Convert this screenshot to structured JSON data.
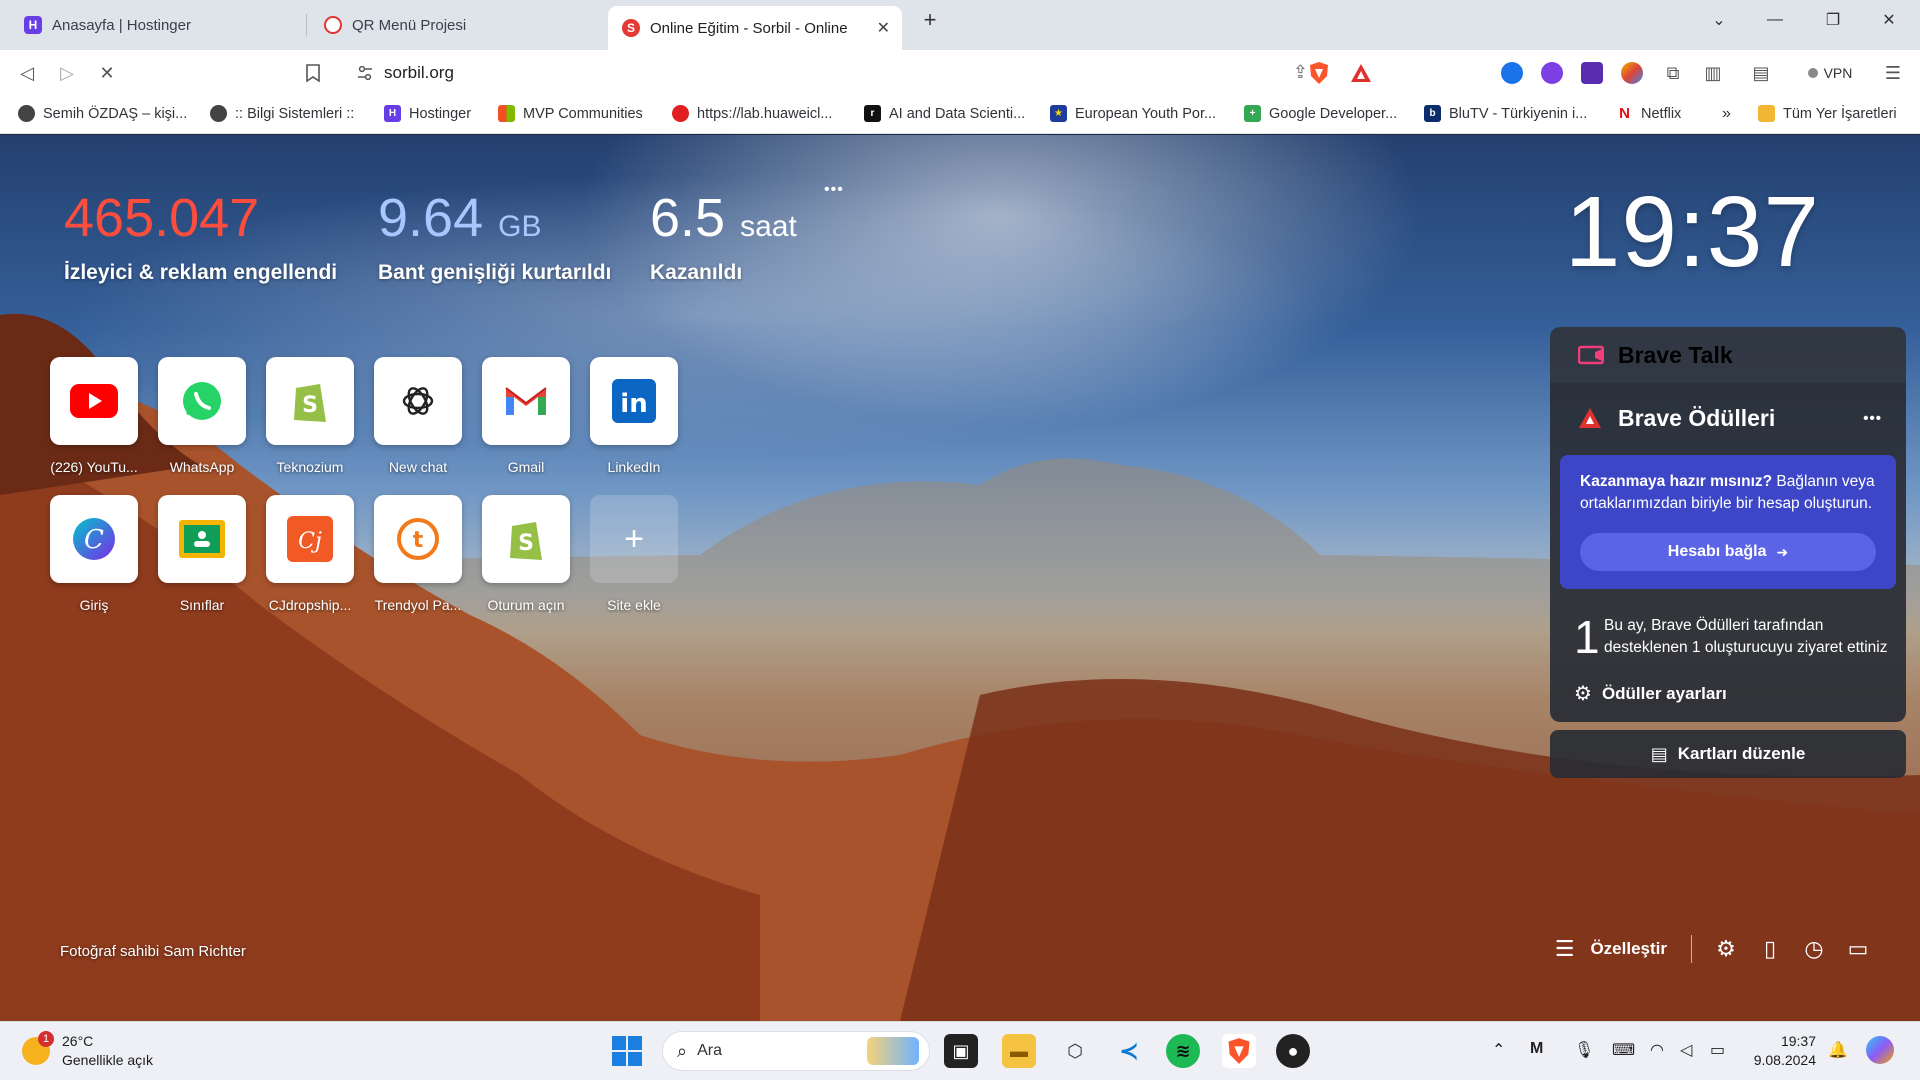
{
  "tabs": [
    {
      "title": "Anasayfa | Hostinger",
      "icon": "hostinger-icon",
      "active": false
    },
    {
      "title": "QR Menü Projesi",
      "icon": "qr-project-icon",
      "active": false
    },
    {
      "title": "Online Eğitim - Sorbil - Online",
      "icon": "sorbil-icon",
      "active": true
    }
  ],
  "address": {
    "url": "sorbil.org"
  },
  "toolbar": {
    "vpn_label": "VPN"
  },
  "bookmarks": [
    {
      "label": "Semih ÖZDAŞ – kişi...",
      "icon": "globe-icon"
    },
    {
      "label": ":: Bilgi Sistemleri ::",
      "icon": "globe-icon"
    },
    {
      "label": "Hostinger",
      "icon": "hostinger-icon"
    },
    {
      "label": "MVP Communities",
      "icon": "microsoft-icon"
    },
    {
      "label": "https://lab.huaweicl...",
      "icon": "huawei-icon"
    },
    {
      "label": "AI and Data Scienti...",
      "icon": "ai-data-icon"
    },
    {
      "label": "European Youth Por...",
      "icon": "eu-flag-icon"
    },
    {
      "label": "Google Developer...",
      "icon": "google-dev-icon"
    },
    {
      "label": "BluTV - Türkiyenin i...",
      "icon": "blutv-icon"
    },
    {
      "label": "Netflix",
      "icon": "netflix-icon"
    }
  ],
  "bookmarks_more": "»",
  "bookmarks_all": "Tüm Yer İşaretleri",
  "stats": {
    "blocked_value": "465.047",
    "blocked_label": "İzleyici & reklam engellendi",
    "bandwidth_value": "9.64",
    "bandwidth_unit": "GB",
    "bandwidth_label": "Bant genişliği kurtarıldı",
    "time_value": "6.5",
    "time_unit": "saat",
    "time_label": "Kazanıldı",
    "menu": "•••"
  },
  "clock": "19:37",
  "top_sites": [
    {
      "label": "(226) YouTu...",
      "icon": "youtube-icon"
    },
    {
      "label": "WhatsApp",
      "icon": "whatsapp-icon"
    },
    {
      "label": "Teknozium",
      "icon": "shopify-icon"
    },
    {
      "label": "New chat",
      "icon": "openai-icon"
    },
    {
      "label": "Gmail",
      "icon": "gmail-icon"
    },
    {
      "label": "LinkedIn",
      "icon": "linkedin-icon"
    },
    {
      "label": "Giriş",
      "icon": "canva-icon"
    },
    {
      "label": "Sınıflar",
      "icon": "classroom-icon"
    },
    {
      "label": "CJdropship...",
      "icon": "cjdropshipping-icon"
    },
    {
      "label": "Trendyol Pa...",
      "icon": "trendyol-icon"
    },
    {
      "label": "Oturum açın",
      "icon": "shopify-icon"
    },
    {
      "label": "Site ekle",
      "icon": "plus-icon"
    }
  ],
  "widgets": {
    "talk_title": "Brave Talk",
    "rewards_title": "Brave Ödülleri",
    "rewards_menu": "•••",
    "promo_bold": "Kazanmaya hazır mısınız?",
    "promo_text": " Bağlanın veya ortaklarımızdan biriyle bir hesap oluşturun.",
    "connect_label": "Hesabı bağla",
    "visited_count": "1",
    "visited_text": "Bu ay, Brave Ödülleri tarafından desteklenen 1 oluşturucuyu ziyaret ettiniz",
    "settings_label": "Ödüller ayarları",
    "edit_cards_label": "Kartları düzenle"
  },
  "photo_credit": {
    "prefix": "Fotoğraf sahibi",
    "author": "Sam Richter"
  },
  "bottom_bar": {
    "customize_label": "Özelleştir"
  },
  "taskbar": {
    "weather_temp": "26°C",
    "weather_desc": "Genellikle açık",
    "weather_badge": "1",
    "search_label": "Ara",
    "time": "19:37",
    "date": "9.08.2024"
  },
  "colors": {
    "brave_orange": "#fb542b",
    "stat_red": "#ff4d3d",
    "stat_blue": "#a9c7ff",
    "rewards_blue": "#3e46c8"
  }
}
